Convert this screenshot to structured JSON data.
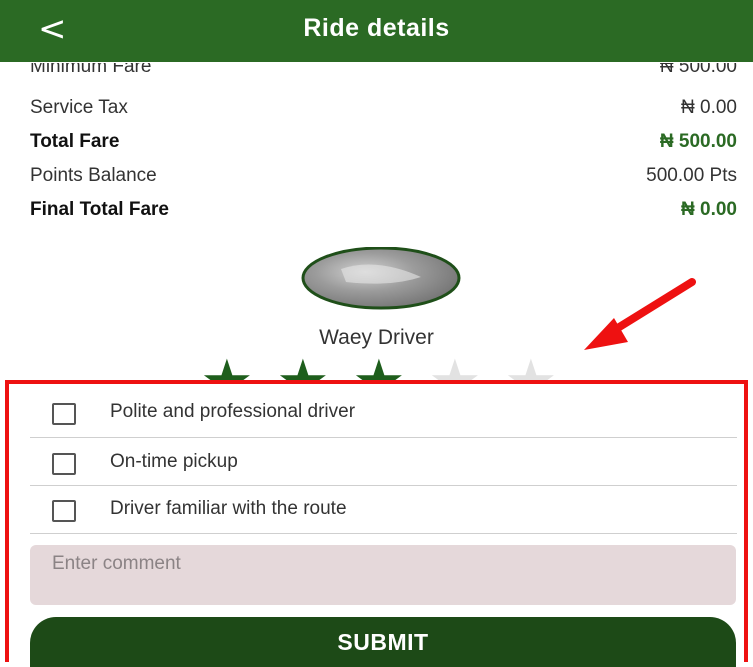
{
  "header": {
    "back_label": "<",
    "title": "Ride details"
  },
  "fare": {
    "rows": [
      {
        "label": "Minimum Fare",
        "value": "₦ 500.00",
        "bold": false
      },
      {
        "label": "Service Tax",
        "value": "₦ 0.00",
        "bold": false
      },
      {
        "label": "Total Fare",
        "value": "₦ 500.00",
        "bold": true
      },
      {
        "label": "Points Balance",
        "value": "500.00 Pts",
        "bold": false
      },
      {
        "label": "Final Total Fare",
        "value": "₦ 0.00",
        "bold": true
      }
    ]
  },
  "driver": {
    "name": "Waey Driver",
    "rating": 3,
    "max_rating": 5
  },
  "feedback": {
    "options": [
      {
        "label": "Polite and professional driver",
        "checked": false
      },
      {
        "label": "On-time pickup",
        "checked": false
      },
      {
        "label": "Driver familiar with the route",
        "checked": false
      }
    ],
    "comment_placeholder": "Enter comment",
    "submit_label": "SUBMIT"
  },
  "colors": {
    "header_bg": "#2b6a24",
    "accent_green": "#2b6a24",
    "button_bg": "#1d4a17",
    "star_on": "#1e5e1c",
    "star_off": "#e2e2e2",
    "annotation_red": "#ee1111",
    "comment_bg": "#e5d8da"
  }
}
